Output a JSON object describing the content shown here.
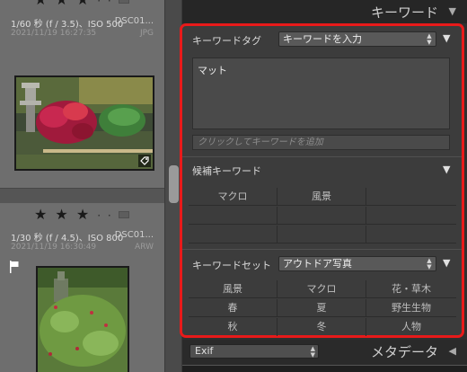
{
  "filmstrip": {
    "top_cell": {
      "stars": "★ ★ ★",
      "dots": "· ·",
      "exposure": "1/60 秒 (f / 3.5)、ISO 500",
      "filename": "DSC01...",
      "date": "2021/11/19 16:27:35",
      "format": "JPG"
    },
    "bottom_cell": {
      "stars": "★ ★ ★",
      "dots": "· ·",
      "exposure": "1/30 秒 (f / 4.5)、ISO 800",
      "filename": "DSC01...",
      "date": "2021/11/19 16:30:49",
      "format": "ARW"
    }
  },
  "panel": {
    "title": "キーワード",
    "collapse_icon": "triangle-down-icon",
    "keyword_tag": {
      "label": "キーワードタグ",
      "dropdown_value": "キーワードを入力",
      "keywords": "マット",
      "add_placeholder": "クリックしてキーワードを追加"
    },
    "suggestions": {
      "label": "候補キーワード",
      "items": [
        "マクロ",
        "風景",
        "",
        "",
        "",
        "",
        "",
        "",
        ""
      ]
    },
    "keyword_set": {
      "label": "キーワードセット",
      "dropdown_value": "アウトドア写真",
      "items": [
        "風景",
        "マクロ",
        "花・草木",
        "春",
        "夏",
        "野生生物",
        "秋",
        "冬",
        "人物"
      ]
    }
  },
  "footer": {
    "preset_value": "Exif",
    "metadata_title": "メタデータ",
    "expand_icon": "triangle-left-icon"
  },
  "colors": {
    "highlight_frame": "#e81a1a",
    "panel_bg": "#3c3c3c",
    "filmstrip_cell": "#6e6e6e"
  }
}
